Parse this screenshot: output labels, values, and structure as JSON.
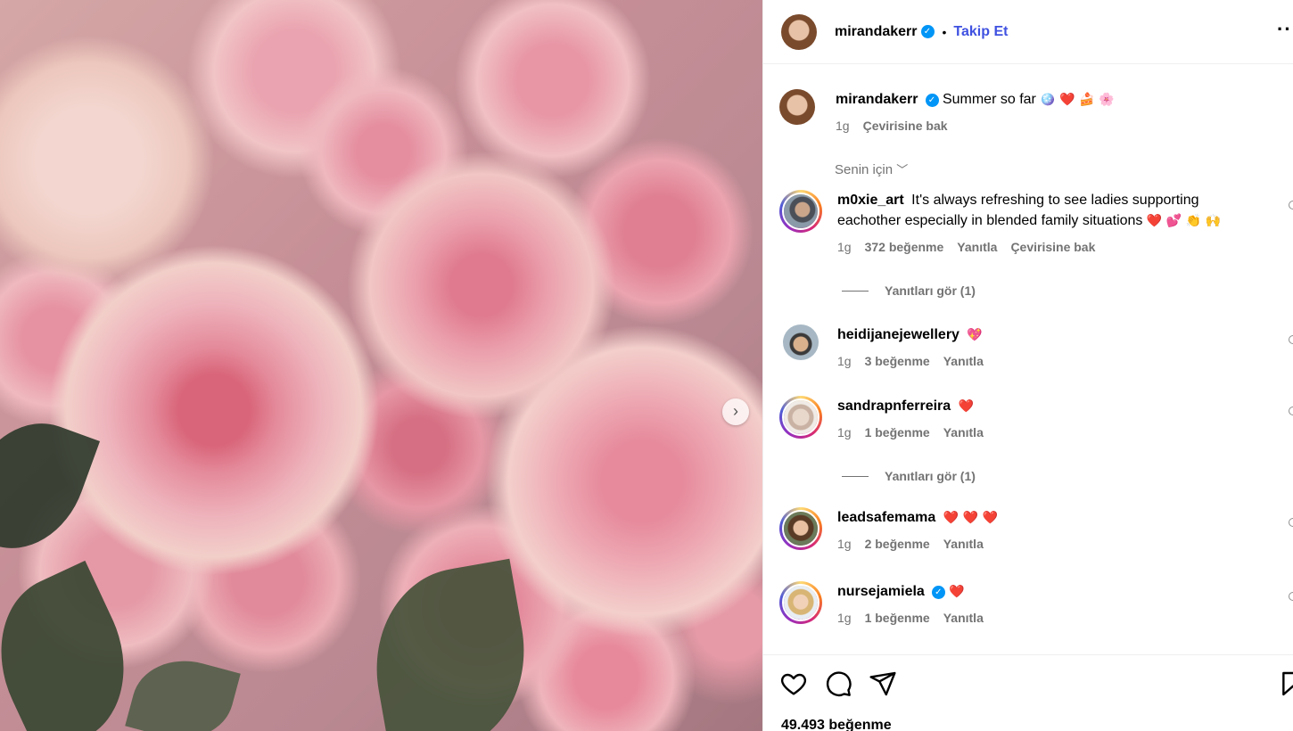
{
  "post": {
    "username": "mirandakerr",
    "follow_label": "Takip Et",
    "dot": "•",
    "caption": "Summer so far",
    "caption_emojis": "🪩 ❤️ 🍰 🌸",
    "caption_time": "1g",
    "translate_label": "Çevirisine bak",
    "likes": "49.493 beğenme"
  },
  "filter": {
    "label": "Senin için"
  },
  "comments": [
    {
      "username": "m0xie_art",
      "text": "It's always refreshing to see ladies supporting eachother especially in blended family situations",
      "emojis": "❤️ 💕 👏 🙌",
      "time": "1g",
      "likes": "372 beğenme",
      "reply": "Yanıtla",
      "translate": "Çevirisine bak",
      "view_replies": "Yanıtları gör (1)"
    },
    {
      "username": "heidijanejewellery",
      "emojis": "💖",
      "time": "1g",
      "likes": "3 beğenme",
      "reply": "Yanıtla"
    },
    {
      "username": "sandrapnferreira",
      "emojis": "❤️",
      "time": "1g",
      "likes": "1 beğenme",
      "reply": "Yanıtla",
      "view_replies": "Yanıtları gör (1)"
    },
    {
      "username": "leadsafemama",
      "emojis": "❤️ ❤️ ❤️",
      "time": "1g",
      "likes": "2 beğenme",
      "reply": "Yanıtla"
    },
    {
      "username": "nursejamiela",
      "emojis": "❤️",
      "time": "1g",
      "likes": "1 beğenme",
      "reply": "Yanıtla"
    }
  ],
  "icons": [
    "like-icon",
    "comment-icon",
    "share-icon",
    "save-icon",
    "more-options-icon",
    "chevron-down-icon",
    "next-arrow-icon",
    "verified-badge-icon"
  ],
  "colors": {
    "follow": "#3f51e0",
    "verified": "#0095f6",
    "meta": "#737373"
  }
}
